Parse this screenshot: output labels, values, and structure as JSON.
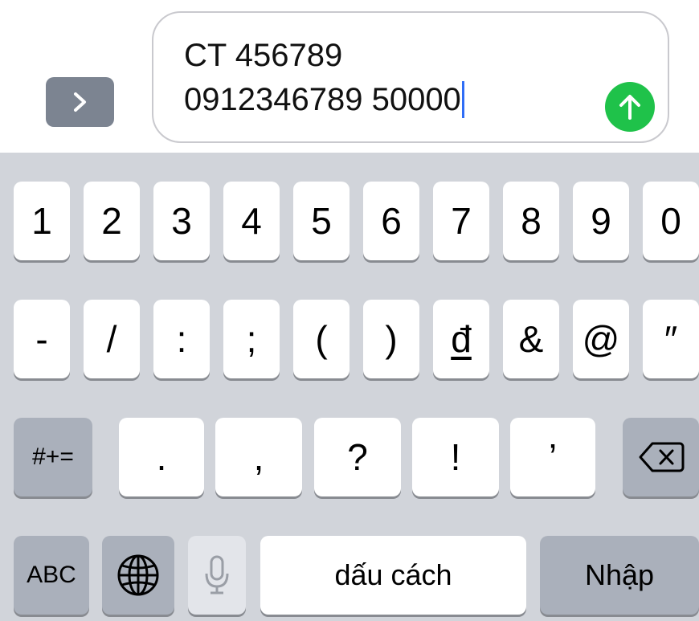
{
  "compose": {
    "message_line1": "CT 456789",
    "message_line2": "0912346789 50000",
    "expand_icon": "chevron-right-icon",
    "send_icon": "arrow-up-icon",
    "colors": {
      "send": "#1fc24a",
      "caret": "#2f6df6"
    }
  },
  "keyboard": {
    "row1": [
      "1",
      "2",
      "3",
      "4",
      "5",
      "6",
      "7",
      "8",
      "9",
      "0"
    ],
    "row2": [
      "-",
      "/",
      ":",
      ";",
      "(",
      ")",
      "đ",
      "&",
      "@",
      "″"
    ],
    "row3_mode": "#+=",
    "row3": [
      ".",
      ",",
      "?",
      "!",
      "’"
    ],
    "backspace_icon": "delete-backward-icon",
    "row4": {
      "abc": "ABC",
      "globe_icon": "globe-icon",
      "mic_icon": "microphone-icon",
      "space": "dấu cách",
      "enter": "Nhập"
    }
  }
}
